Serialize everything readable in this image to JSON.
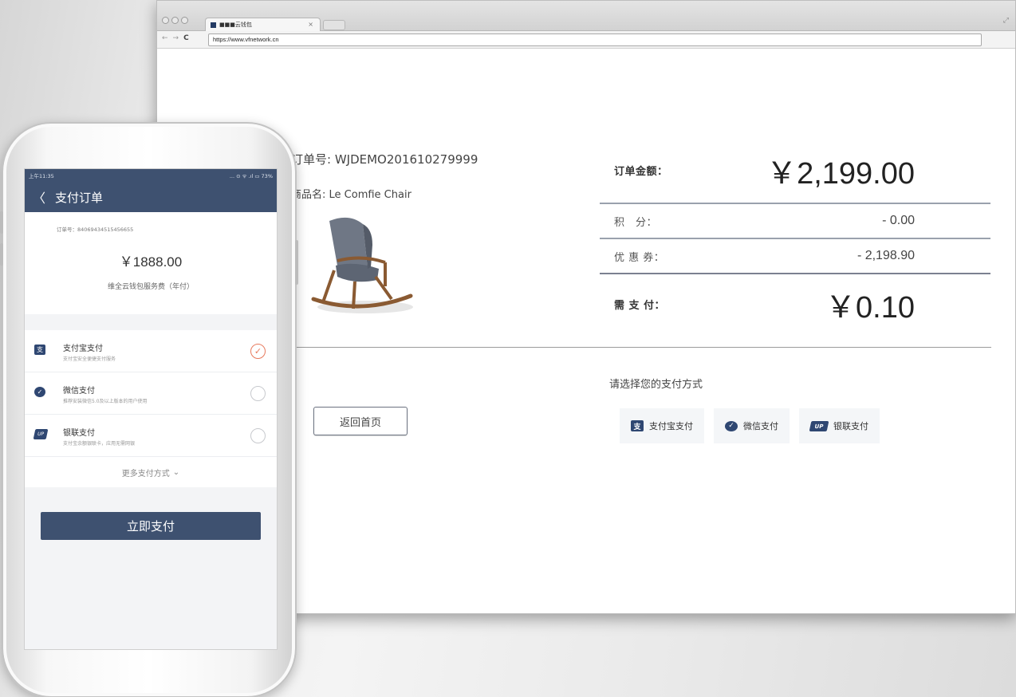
{
  "browser": {
    "tab_title": "■■■云钱包",
    "url": "https://www.vfnetwork.cn"
  },
  "web": {
    "order_no": "订单号: WJDEMO201610279999",
    "product_name": "商品名: Le Comfie Chair",
    "summary": {
      "amount_label": "订单金额：",
      "amount_value": "￥2,199.00",
      "points_label": "积　分：",
      "points_value": "- 0.00",
      "coupon_label": "优 惠 券：",
      "coupon_value": "- 2,198.90",
      "pay_label": "需 支 付：",
      "pay_value": "￥0.10"
    },
    "back_home_label": "返回首页",
    "pay_title": "请选择您的支付方式",
    "pay_methods": [
      {
        "label": "支付宝支付",
        "icon": "alipay-icon"
      },
      {
        "label": "微信支付",
        "icon": "wechat-pay-icon"
      },
      {
        "label": "银联支付",
        "icon": "unionpay-icon"
      }
    ]
  },
  "mobile": {
    "status_time": "上午11:35",
    "status_right": "... ⊙ ᯤ .ıl ▭ 73%",
    "header_title": "支付订单",
    "order_no": "订单号：84069434515456655",
    "amount": "￥1888.00",
    "description": "维全云钱包服务费（年付）",
    "methods": [
      {
        "title": "支付宝支付",
        "sub": "支付宝安全便捷支付服务",
        "checked": true
      },
      {
        "title": "微信支付",
        "sub": "推荐安装微信5.0及以上版本的用户使用",
        "checked": false
      },
      {
        "title": "银联支付",
        "sub": "支付宝余额银联卡，应用无需网银",
        "checked": false
      }
    ],
    "more_label": "更多支付方式",
    "pay_button": "立即支付"
  },
  "colors": {
    "brand_navy": "#3e5170",
    "check_orange": "#e77a5d"
  }
}
